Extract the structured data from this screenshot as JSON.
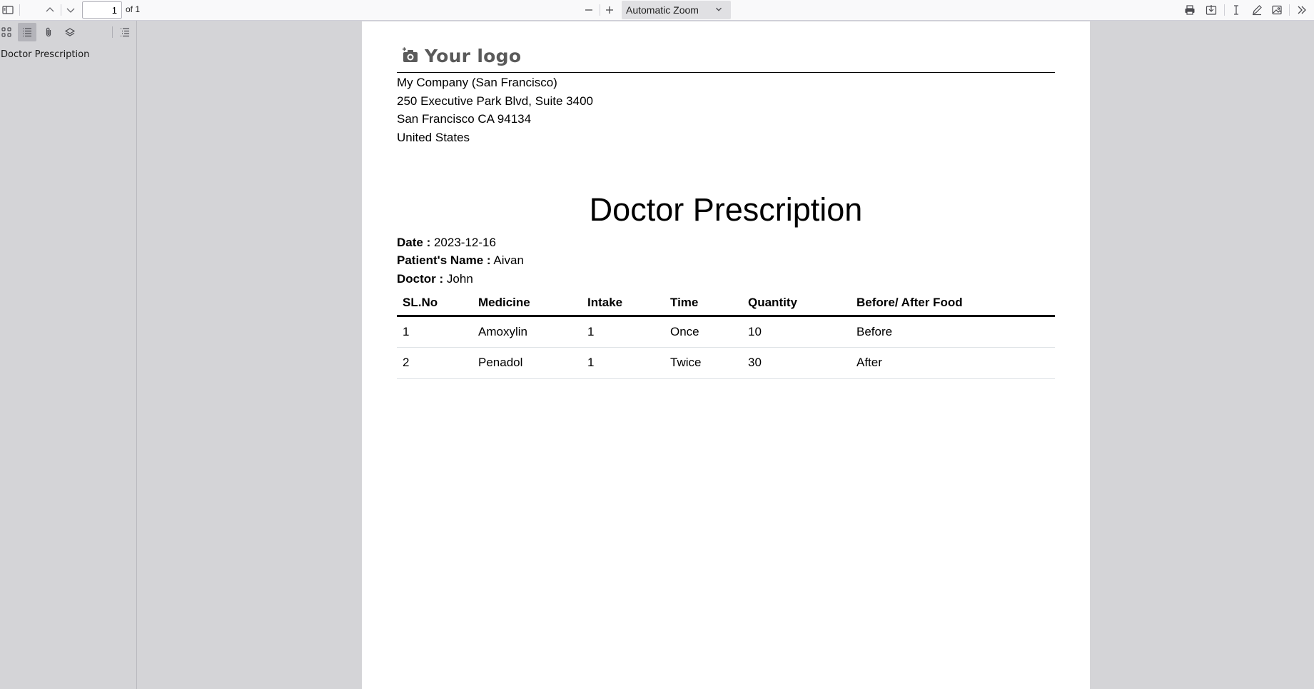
{
  "toolbar": {
    "page_number": "1",
    "page_of": "of 1",
    "zoom_label": "Automatic Zoom"
  },
  "sidebar": {
    "outline_items": [
      "Doctor Prescription"
    ]
  },
  "document": {
    "logo_text": "Your logo",
    "company": {
      "name": "My Company (San Francisco)",
      "street": "250 Executive Park Blvd, Suite 3400",
      "city": "San Francisco CA 94134",
      "country": "United States"
    },
    "title": "Doctor Prescription",
    "date_label": "Date :",
    "date_value": "2023-12-16",
    "patient_label": "Patient's Name :",
    "patient_value": "Aivan",
    "doctor_label": "Doctor :",
    "doctor_value": "John",
    "table": {
      "headers": [
        "SL.No",
        "Medicine",
        "Intake",
        "Time",
        "Quantity",
        "Before/ After Food"
      ],
      "rows": [
        [
          "1",
          "Amoxylin",
          "1",
          "Once",
          "10",
          "Before"
        ],
        [
          "2",
          "Penadol",
          "1",
          "Twice",
          "30",
          "After"
        ]
      ]
    }
  },
  "icons": {
    "toggle_sidebar": "sidebar-toggle-icon",
    "previous_page": "chevron-up-icon",
    "next_page": "chevron-down-icon",
    "zoom_out": "minus-icon",
    "zoom_in": "plus-icon",
    "print": "printer-icon",
    "save": "download-icon",
    "text_select": "text-cursor-icon",
    "draw": "pencil-icon",
    "image": "image-icon",
    "more": "double-chevron-right-icon",
    "logo": "camera-icon"
  }
}
